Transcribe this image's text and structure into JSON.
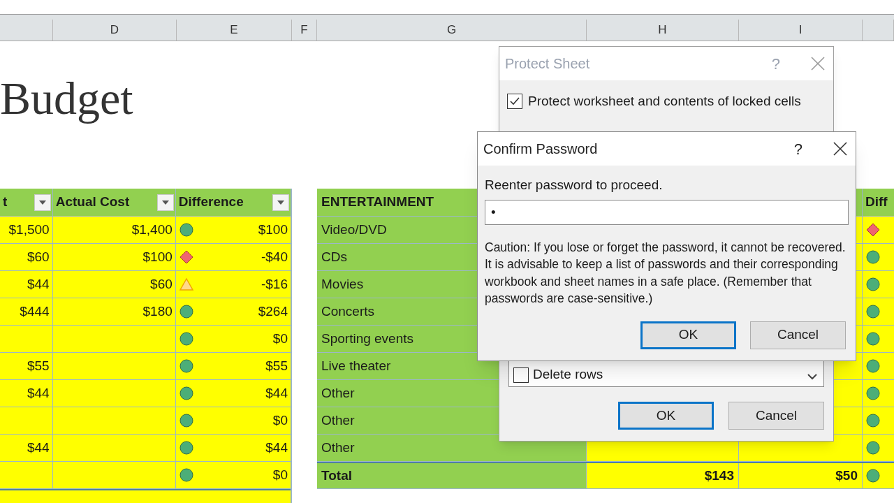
{
  "column_headers": [
    "D",
    "E",
    "F",
    "G",
    "H",
    "I"
  ],
  "title": "Budget",
  "left_table": {
    "columns": [
      {
        "label": "t",
        "filter": true
      },
      {
        "label": "Actual Cost",
        "filter": true
      },
      {
        "label": "Difference",
        "filter": true
      }
    ],
    "rows": [
      {
        "cells": [
          "$1,500",
          "$1,400"
        ],
        "kind": "circle",
        "difference": "$100"
      },
      {
        "cells": [
          "$60",
          "$100"
        ],
        "kind": "diamond",
        "difference": "-$40"
      },
      {
        "cells": [
          "$44",
          "$60"
        ],
        "kind": "triangle",
        "difference": "-$16"
      },
      {
        "cells": [
          "$444",
          "$180"
        ],
        "kind": "circle",
        "difference": "$264"
      },
      {
        "cells": [
          "",
          ""
        ],
        "kind": "circle",
        "difference": "$0"
      },
      {
        "cells": [
          "$55",
          ""
        ],
        "kind": "circle",
        "difference": "$55"
      },
      {
        "cells": [
          "$44",
          ""
        ],
        "kind": "circle",
        "difference": "$44"
      },
      {
        "cells": [
          "",
          ""
        ],
        "kind": "circle",
        "difference": "$0"
      },
      {
        "cells": [
          "$44",
          ""
        ],
        "kind": "circle",
        "difference": "$44"
      },
      {
        "cells": [
          "",
          ""
        ],
        "kind": "circle",
        "difference": "$0"
      }
    ]
  },
  "right_table": {
    "header": "ENTERTAINMENT",
    "column_4_header": "Diff",
    "rows": [
      {
        "label": "Video/DVD",
        "kind": "diamond"
      },
      {
        "label": "CDs",
        "kind": "circle"
      },
      {
        "label": "Movies",
        "kind": "circle"
      },
      {
        "label": "Concerts",
        "kind": "circle"
      },
      {
        "label": "Sporting events",
        "kind": "circle"
      },
      {
        "label": "Live theater",
        "kind": "circle"
      },
      {
        "label": "Other",
        "kind": "circle"
      },
      {
        "label": "Other",
        "kind": "circle"
      },
      {
        "label": "Other",
        "kind": "circle"
      }
    ],
    "total": {
      "label": "Total",
      "values": [
        "$143",
        "$50"
      ],
      "kind": "circle"
    }
  },
  "protect_sheet_dialog": {
    "title": "Protect Sheet",
    "help": "?",
    "protect_checkbox": {
      "label": "Protect worksheet and contents of locked cells",
      "checked": true
    },
    "permissions": [
      {
        "label": "Delete rows",
        "checked": false
      }
    ],
    "buttons": [
      {
        "label": "OK",
        "default": true
      },
      {
        "label": "Cancel",
        "default": false
      }
    ]
  },
  "confirm_password_dialog": {
    "title": "Confirm Password",
    "help": "?",
    "prompt": "Reenter password to proceed.",
    "password": "•",
    "caution": "Caution: If you lose or forget the password, it cannot be recovered. It is advisable to keep a list of passwords and their corresponding workbook and sheet names in a safe place.  (Remember that passwords are case-sensitive.)",
    "buttons": [
      {
        "label": "OK",
        "default": true
      },
      {
        "label": "Cancel",
        "default": false
      }
    ]
  }
}
